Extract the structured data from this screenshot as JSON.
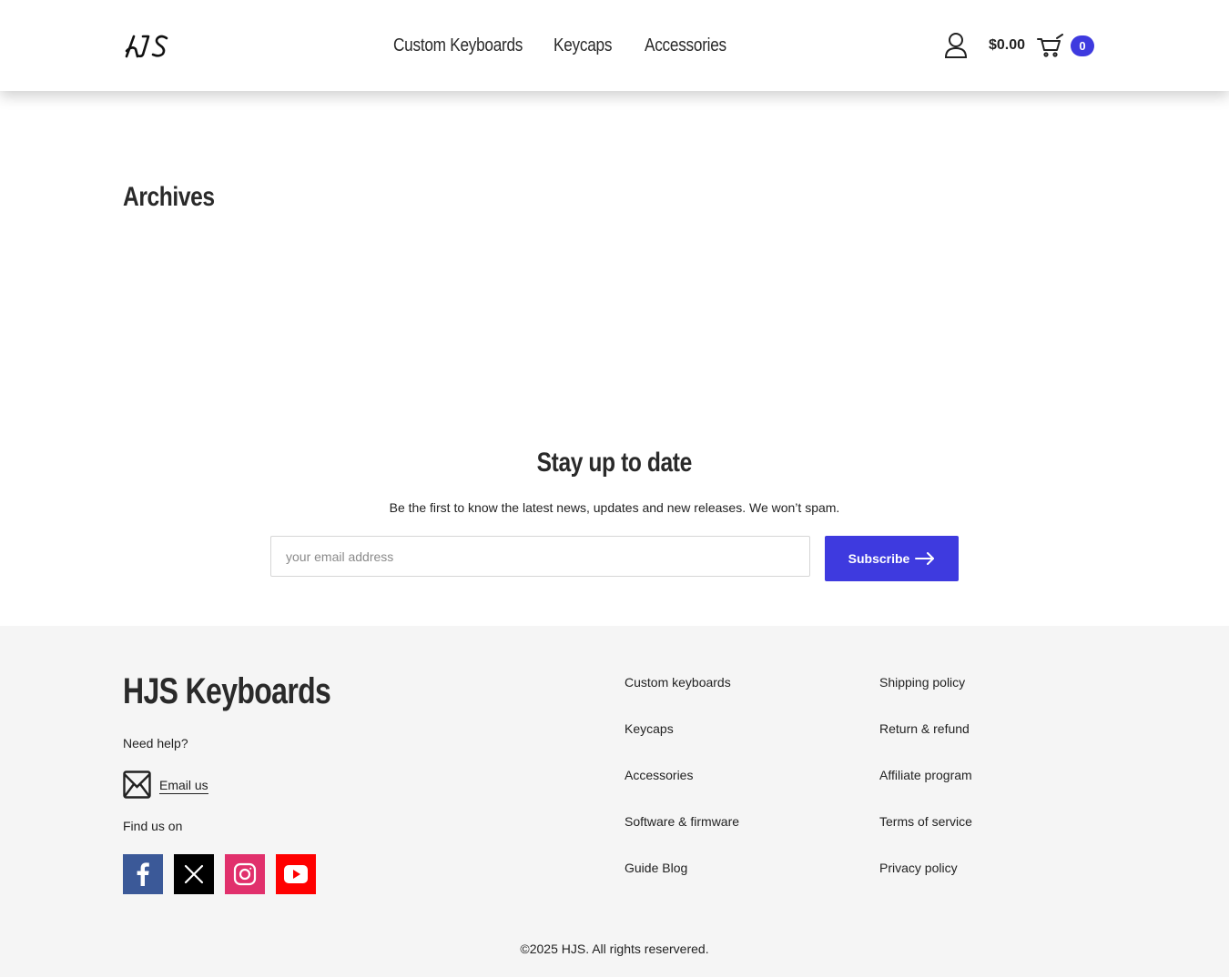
{
  "header": {
    "logo_alt": "HJS",
    "nav": [
      {
        "label": "Custom Keyboards"
      },
      {
        "label": "Keycaps"
      },
      {
        "label": "Accessories"
      }
    ],
    "cart_total": "$0.00",
    "cart_count": "0"
  },
  "main": {
    "title": "Archives"
  },
  "newsletter": {
    "title": "Stay up to date",
    "subtitle": "Be the first to know the latest news, updates and new releases. We won’t spam.",
    "email_placeholder": "your email address",
    "subscribe_label": "Subscribe"
  },
  "footer": {
    "brand": "HJS Keyboards",
    "need_help": "Need help?",
    "email_label": "Email us",
    "find_us": "Find us on",
    "col1": [
      {
        "label": "Custom keyboards"
      },
      {
        "label": "Keycaps"
      },
      {
        "label": "Accessories"
      },
      {
        "label": "Software & firmware"
      },
      {
        "label": "Guide Blog"
      }
    ],
    "col2": [
      {
        "label": "Shipping policy"
      },
      {
        "label": "Return & refund"
      },
      {
        "label": "Affiliate program"
      },
      {
        "label": "Terms of service"
      },
      {
        "label": "Privacy policy"
      }
    ],
    "copyright": "©2025 HJS. All rights reservered."
  },
  "colors": {
    "accent": "#3e3adf",
    "footer_bg": "#f5f5f5",
    "facebook": "#3b5998",
    "x": "#000000",
    "instagram": "#e1306c",
    "youtube": "#ff0000"
  },
  "icons": [
    "hjs-logo-icon",
    "user-icon",
    "cart-icon",
    "arrow-right-icon",
    "mail-icon",
    "facebook-icon",
    "x-icon",
    "instagram-icon",
    "youtube-icon"
  ]
}
